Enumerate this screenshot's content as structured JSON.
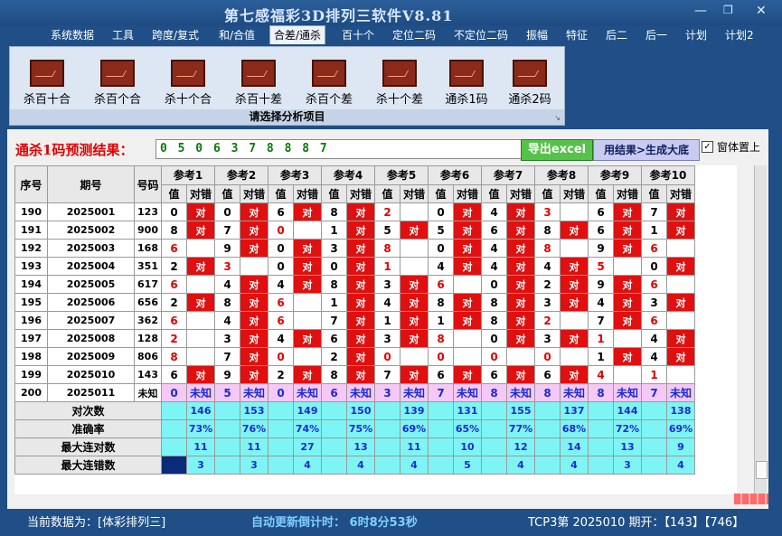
{
  "window": {
    "title": "第七感福彩3D排列三软件V8.81",
    "minimize_icon": "minimize-icon",
    "restore_icon": "restore-icon",
    "close_icon": "close-icon"
  },
  "menu": [
    "系统数据",
    "工具",
    "跨度/复式",
    "和/合值",
    "合差/通杀",
    "百十个",
    "定位二码",
    "不定位二码",
    "振幅",
    "特征",
    "后二",
    "后一",
    "计划",
    "计划2"
  ],
  "ribbon": {
    "buttons": [
      "杀百十合",
      "杀百个合",
      "杀十个合",
      "杀百十差",
      "杀百个差",
      "杀十个差",
      "通杀1码",
      "通杀2码"
    ],
    "caption": "请选择分析项目"
  },
  "prediction": {
    "label": "通杀1码预测结果：",
    "value": "0 5 0 6 3 7 8 8 8 7",
    "excel_button": "导出excel",
    "generate_button": "用结果>生成大底",
    "pin_checkbox_label": "窗体置上",
    "pin_checked": true
  },
  "table": {
    "headers": [
      "序号",
      "期号",
      "号码"
    ],
    "ref_groups": [
      "参考1",
      "参考2",
      "参考3",
      "参考4",
      "参考5",
      "参考6",
      "参考7",
      "参考8",
      "参考9",
      "参考10"
    ],
    "sub_headers": [
      "值",
      "对错"
    ],
    "ok_text": "对",
    "rows": [
      {
        "seq": "190",
        "issue": "2025001",
        "num": "123",
        "vals": [
          "0",
          "0",
          "6",
          "8",
          "2",
          "0",
          "4",
          "3",
          "6",
          "7"
        ],
        "ok": [
          1,
          1,
          1,
          1,
          0,
          1,
          1,
          0,
          1,
          1
        ],
        "red": [
          0,
          0,
          0,
          0,
          1,
          0,
          0,
          1,
          0,
          0
        ]
      },
      {
        "seq": "191",
        "issue": "2025002",
        "num": "900",
        "vals": [
          "8",
          "7",
          "0",
          "1",
          "5",
          "5",
          "6",
          "8",
          "6",
          "1"
        ],
        "ok": [
          1,
          1,
          0,
          1,
          1,
          1,
          1,
          1,
          1,
          1
        ],
        "red": [
          0,
          0,
          1,
          0,
          0,
          0,
          0,
          0,
          0,
          0
        ]
      },
      {
        "seq": "192",
        "issue": "2025003",
        "num": "168",
        "vals": [
          "6",
          "9",
          "0",
          "3",
          "8",
          "0",
          "4",
          "8",
          "9",
          "6"
        ],
        "ok": [
          0,
          1,
          1,
          1,
          0,
          1,
          1,
          0,
          1,
          0
        ],
        "red": [
          1,
          0,
          0,
          0,
          1,
          0,
          0,
          1,
          0,
          1
        ]
      },
      {
        "seq": "193",
        "issue": "2025004",
        "num": "351",
        "vals": [
          "2",
          "3",
          "0",
          "0",
          "1",
          "4",
          "4",
          "4",
          "5",
          "0"
        ],
        "ok": [
          1,
          0,
          1,
          1,
          0,
          1,
          1,
          1,
          0,
          1
        ],
        "red": [
          0,
          1,
          0,
          0,
          1,
          0,
          0,
          0,
          1,
          0
        ]
      },
      {
        "seq": "194",
        "issue": "2025005",
        "num": "617",
        "vals": [
          "6",
          "4",
          "4",
          "8",
          "3",
          "6",
          "0",
          "2",
          "9",
          "6"
        ],
        "ok": [
          0,
          1,
          1,
          1,
          1,
          0,
          1,
          1,
          1,
          0
        ],
        "red": [
          1,
          0,
          0,
          0,
          0,
          1,
          0,
          0,
          0,
          1
        ]
      },
      {
        "seq": "195",
        "issue": "2025006",
        "num": "656",
        "vals": [
          "2",
          "8",
          "6",
          "1",
          "4",
          "8",
          "8",
          "3",
          "4",
          "3"
        ],
        "ok": [
          1,
          1,
          0,
          1,
          1,
          1,
          1,
          1,
          1,
          1
        ],
        "red": [
          0,
          0,
          1,
          0,
          0,
          0,
          0,
          0,
          0,
          0
        ]
      },
      {
        "seq": "196",
        "issue": "2025007",
        "num": "362",
        "vals": [
          "6",
          "4",
          "6",
          "7",
          "1",
          "1",
          "8",
          "2",
          "7",
          "6"
        ],
        "ok": [
          0,
          1,
          0,
          1,
          1,
          1,
          1,
          0,
          1,
          0
        ],
        "red": [
          1,
          0,
          1,
          0,
          0,
          0,
          0,
          1,
          0,
          1
        ]
      },
      {
        "seq": "197",
        "issue": "2025008",
        "num": "128",
        "vals": [
          "2",
          "3",
          "4",
          "6",
          "3",
          "8",
          "0",
          "3",
          "1",
          "4"
        ],
        "ok": [
          0,
          1,
          1,
          1,
          1,
          0,
          1,
          1,
          0,
          1
        ],
        "red": [
          1,
          0,
          0,
          0,
          0,
          1,
          0,
          0,
          1,
          0
        ]
      },
      {
        "seq": "198",
        "issue": "2025009",
        "num": "806",
        "vals": [
          "8",
          "7",
          "0",
          "2",
          "0",
          "0",
          "0",
          "0",
          "1",
          "4"
        ],
        "ok": [
          0,
          1,
          0,
          1,
          0,
          0,
          0,
          0,
          1,
          1
        ],
        "red": [
          1,
          0,
          1,
          0,
          1,
          1,
          1,
          1,
          0,
          0
        ]
      },
      {
        "seq": "199",
        "issue": "2025010",
        "num": "143",
        "vals": [
          "6",
          "9",
          "2",
          "8",
          "7",
          "6",
          "6",
          "6",
          "4",
          "1"
        ],
        "ok": [
          1,
          1,
          1,
          1,
          1,
          1,
          1,
          1,
          0,
          0
        ],
        "red": [
          0,
          0,
          0,
          0,
          0,
          0,
          0,
          0,
          1,
          1
        ]
      }
    ],
    "pending_row": {
      "seq": "200",
      "issue": "2025011",
      "num": "未知",
      "vals": [
        "0",
        "5",
        "0",
        "6",
        "3",
        "7",
        "8",
        "8",
        "8",
        "7"
      ],
      "status": "未知"
    },
    "stats": [
      {
        "label": "对次数",
        "values": [
          "146",
          "153",
          "149",
          "150",
          "139",
          "131",
          "155",
          "137",
          "144",
          "138"
        ]
      },
      {
        "label": "准确率",
        "values": [
          "73%",
          "76%",
          "74%",
          "75%",
          "69%",
          "65%",
          "77%",
          "68%",
          "72%",
          "69%"
        ]
      },
      {
        "label": "最大连对数",
        "values": [
          "11",
          "11",
          "27",
          "13",
          "11",
          "10",
          "12",
          "14",
          "13",
          "9"
        ]
      },
      {
        "label": "最大连错数",
        "values": [
          "3",
          "3",
          "4",
          "4",
          "4",
          "5",
          "4",
          "4",
          "3",
          "4"
        ]
      }
    ]
  },
  "status": {
    "current_data": "当前数据为：[体彩排列三]",
    "countdown": "自动更新倒计时： 6时8分53秒",
    "latest": "TCP3第 2025010 期开：【143】【746】"
  }
}
